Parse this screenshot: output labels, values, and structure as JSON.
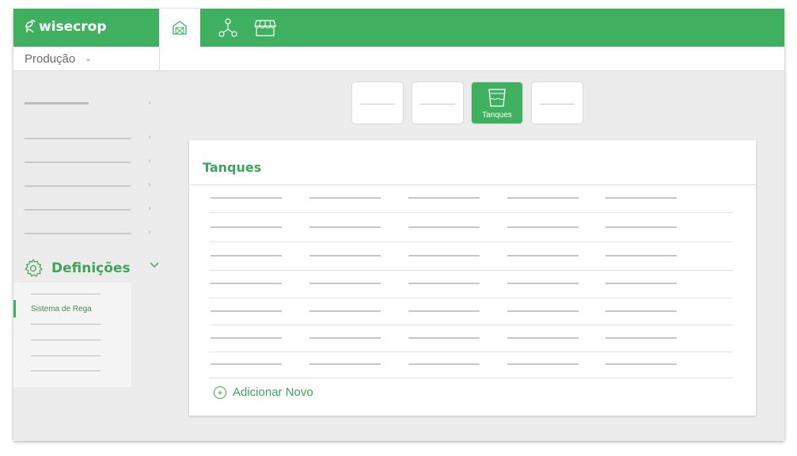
{
  "app": {
    "name": "wisecrop"
  },
  "nav": {
    "icons": [
      "greenhouse-icon",
      "network-icon",
      "market-icon"
    ]
  },
  "production": {
    "label": "Produção"
  },
  "sidebar": {
    "settings_label": "Definições",
    "submenu": {
      "active_item": "Sistema de Rega"
    }
  },
  "tabs": {
    "active_label": "Tanques"
  },
  "panel": {
    "title": "Tanques",
    "add_new_label": "Adicionar Novo"
  },
  "colors": {
    "brand_green": "#3fb05f",
    "text_green": "#3fa35a"
  }
}
